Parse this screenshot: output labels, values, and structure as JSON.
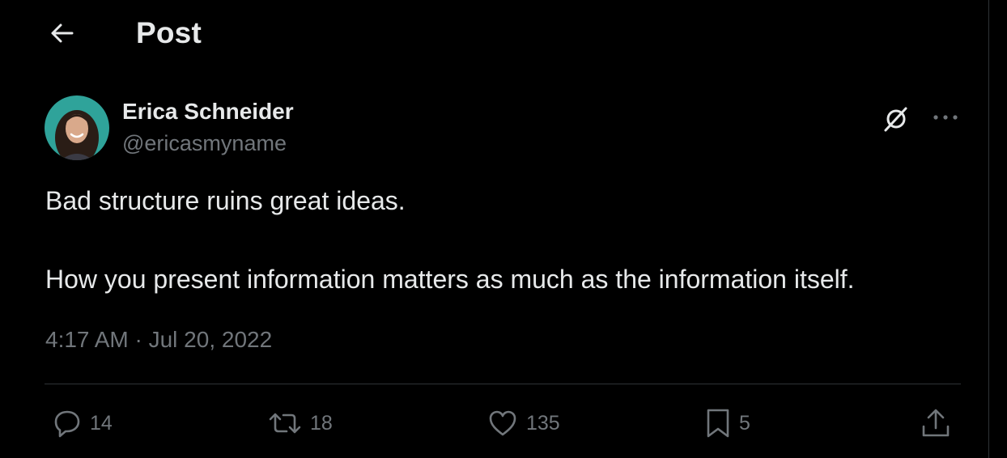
{
  "header": {
    "title": "Post",
    "back_icon": "arrow-left-icon"
  },
  "post": {
    "author": {
      "name": "Erica Schneider",
      "handle": "@ericasmyname",
      "avatar_bg": "#2fa39a"
    },
    "text_line1": "Bad structure ruins great ideas.",
    "text_line2": "How you present information matters as much as the information itself.",
    "timestamp": "4:17 AM · Jul 20, 2022"
  },
  "actions": {
    "reply": {
      "icon": "reply-bubble-icon",
      "count": "14"
    },
    "repost": {
      "icon": "repost-arrows-icon",
      "count": "18"
    },
    "like": {
      "icon": "heart-icon",
      "count": "135"
    },
    "bookmark": {
      "icon": "bookmark-icon",
      "count": "5"
    },
    "share": {
      "icon": "share-upload-icon"
    }
  },
  "colors": {
    "background": "#000000",
    "text_primary": "#e7e9ea",
    "text_secondary": "#71767b",
    "divider": "#2f3336"
  }
}
